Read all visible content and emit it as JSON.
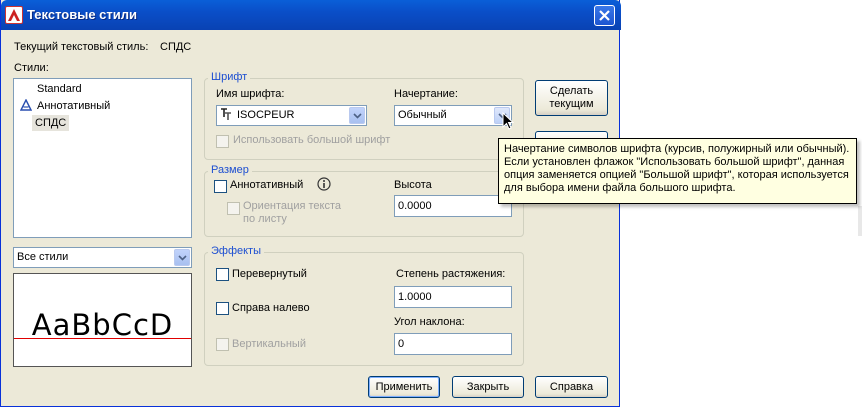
{
  "window": {
    "title": "Текстовые стили"
  },
  "current_style": {
    "label": "Текущий текстовый стиль:",
    "value": "СПДС"
  },
  "styles": {
    "label": "Стили:",
    "items": [
      "Standard",
      "Аннотативный",
      "СПДС"
    ],
    "selected": "СПДС"
  },
  "filter": {
    "value": "Все стили"
  },
  "preview": {
    "text": "AaBbCcD"
  },
  "font_group": {
    "title": "Шрифт",
    "font_name_label": "Имя шрифта:",
    "font_name_value": "ISOCPEUR",
    "font_style_label": "Начертание:",
    "font_style_value": "Обычный",
    "big_font_label": "Использовать большой шрифт"
  },
  "size_group": {
    "title": "Размер",
    "annotative_label": "Аннотативный",
    "orientation_label_1": "Ориентация текста",
    "orientation_label_2": "по листу",
    "height_label": "Высота",
    "height_value": "0.0000"
  },
  "effects_group": {
    "title": "Эффекты",
    "upside_down_label": "Перевернутый",
    "backwards_label": "Справа налево",
    "vertical_label": "Вертикальный",
    "width_factor_label": "Степень растяжения:",
    "width_factor_value": "1.0000",
    "oblique_label": "Угол наклона:",
    "oblique_value": "0"
  },
  "buttons": {
    "set_current_1": "Сделать",
    "set_current_2": "текущим",
    "apply": "Применить",
    "close": "Закрыть",
    "help": "Справка"
  },
  "tooltip": {
    "line1": "Начертание символов шрифта (курсив, полужирный или обычный).",
    "line2": "Если установлен флажок \"Использовать большой шрифт\", данная",
    "line3": "опция заменяется опцией \"Большой шрифт\", которая используется",
    "line4": "для выбора имени файла большого шрифта."
  },
  "colors": {
    "titlebar": "#0a4ec8",
    "dialog_bg": "#ece9d8",
    "group_title": "#1c4ed1",
    "preview_baseline": "#e00000",
    "tooltip_bg": "#ffffe1"
  },
  "icons": {
    "app": "autocad-icon",
    "close": "close-icon",
    "annotative": "annotative-icon",
    "truetype": "truetype-font-icon",
    "info": "info-icon",
    "dropdown": "chevron-down-icon",
    "cursor": "mouse-cursor-icon"
  }
}
